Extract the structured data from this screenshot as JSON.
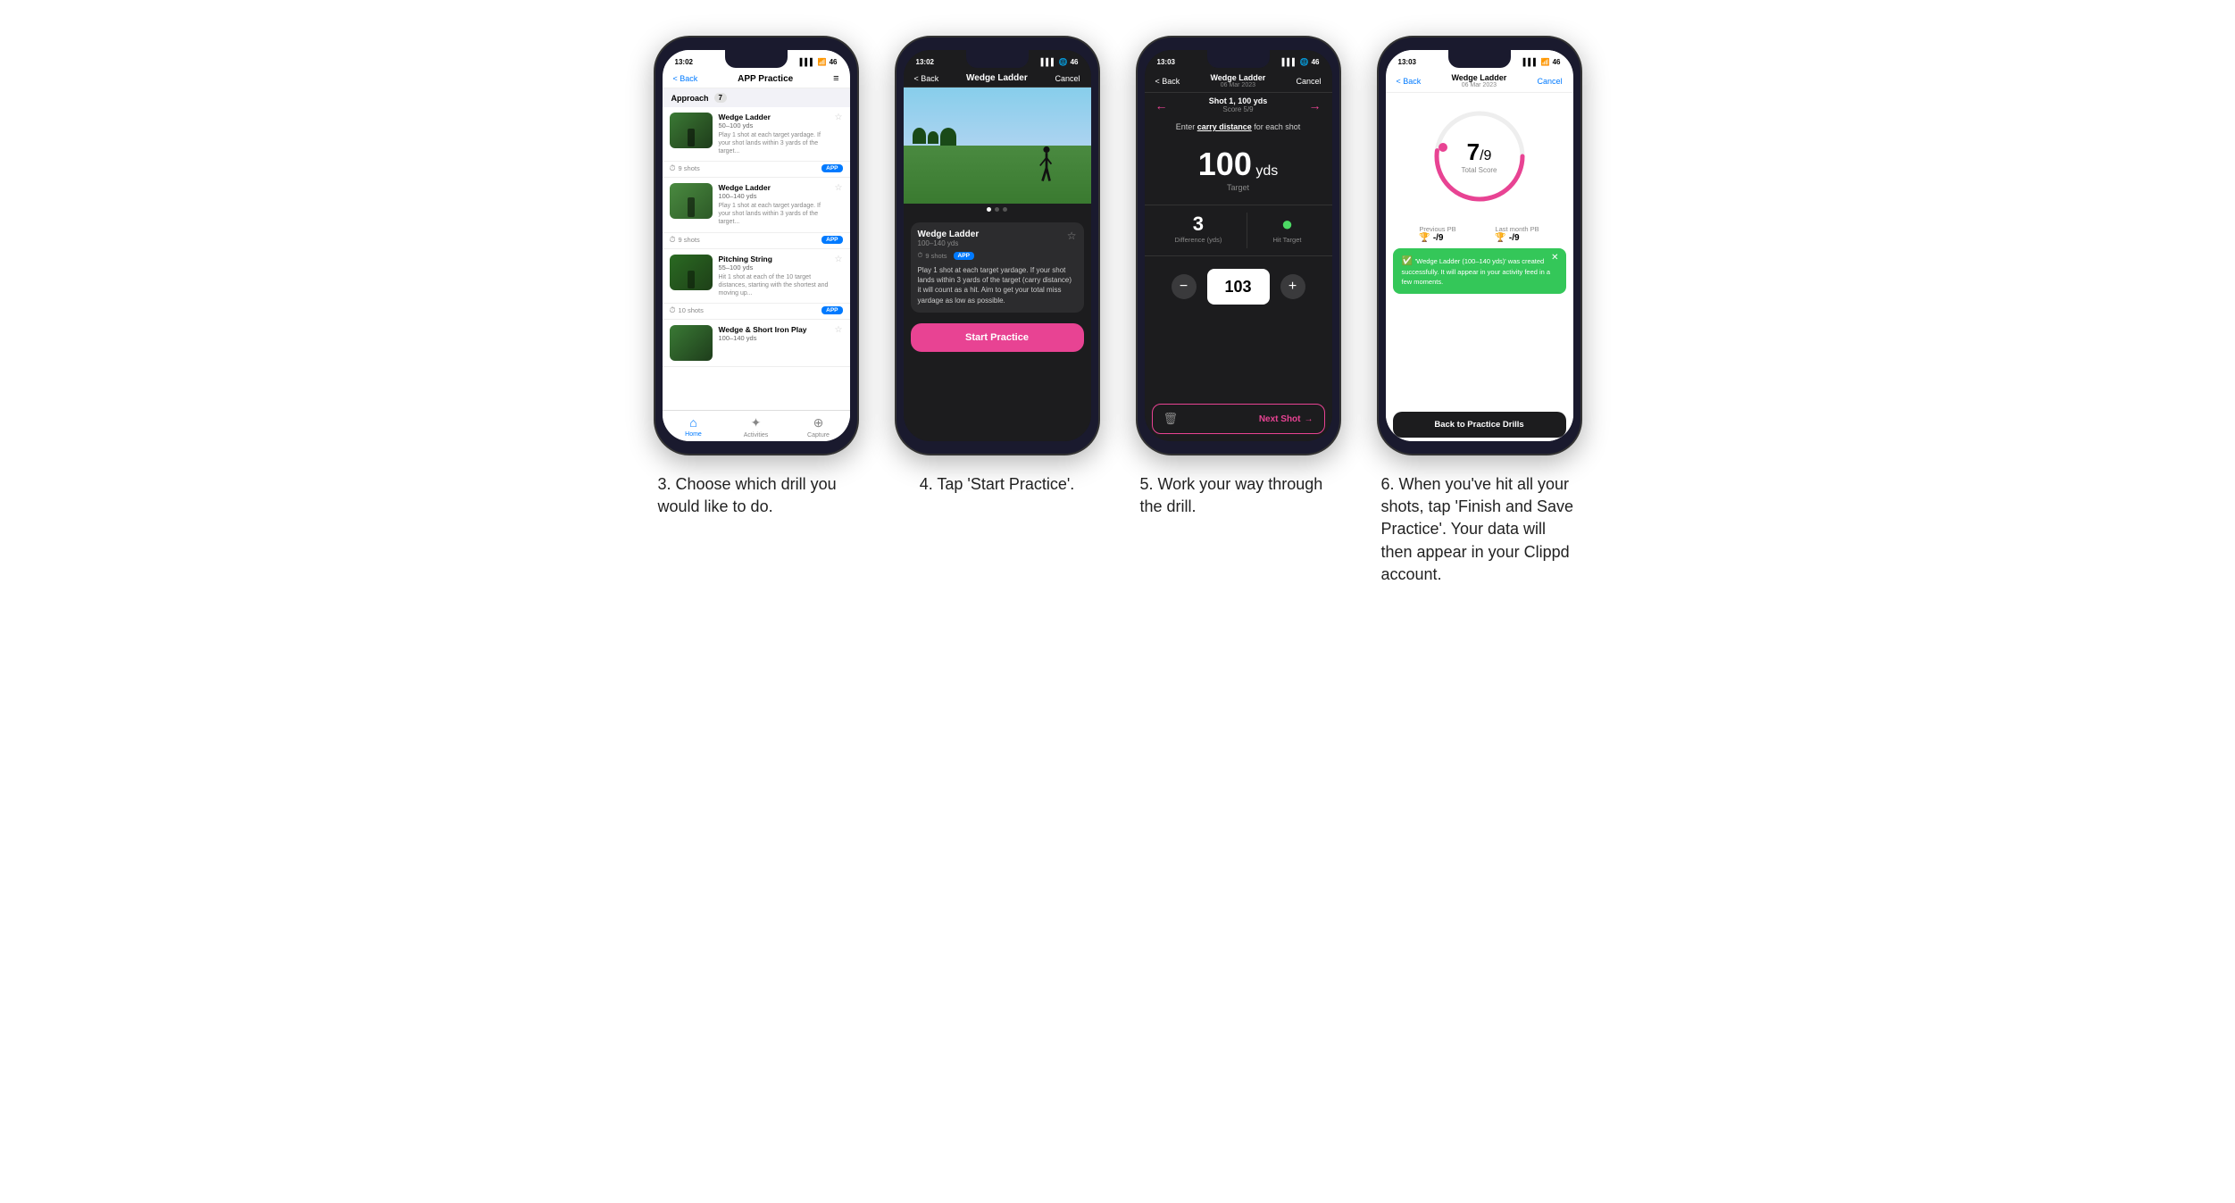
{
  "phones": [
    {
      "id": "phone3",
      "status_time": "13:02",
      "nav": {
        "back": "< Back",
        "title": "APP Practice",
        "icon": "≡"
      },
      "section": "Approach",
      "section_count": "7",
      "drills": [
        {
          "name": "Wedge Ladder",
          "range": "50–100 yds",
          "desc": "Play 1 shot at each target yardage. If your shot lands within 3 yards of the target...",
          "shots": "9 shots",
          "badge": "APP"
        },
        {
          "name": "Wedge Ladder",
          "range": "100–140 yds",
          "desc": "Play 1 shot at each target yardage. If your shot lands within 3 yards of the target...",
          "shots": "9 shots",
          "badge": "APP"
        },
        {
          "name": "Pitching String",
          "range": "55–100 yds",
          "desc": "Hit 1 shot at each of the 10 target distances, starting with the shortest and moving up...",
          "shots": "10 shots",
          "badge": "APP"
        },
        {
          "name": "Wedge & Short Iron Play",
          "range": "100–140 yds",
          "desc": "",
          "shots": "",
          "badge": ""
        }
      ],
      "tabs": [
        "Home",
        "Activities",
        "Capture"
      ]
    },
    {
      "id": "phone4",
      "status_time": "13:02",
      "nav": {
        "back": "< Back",
        "title": "Wedge Ladder",
        "cancel": "Cancel"
      },
      "drill_name": "Wedge Ladder",
      "drill_range": "100–140 yds",
      "shots": "9 shots",
      "badge": "APP",
      "description": "Play 1 shot at each target yardage. If your shot lands within 3 yards of the target (carry distance) it will count as a hit. Aim to get your total miss yardage as low as possible.",
      "start_btn": "Start Practice"
    },
    {
      "id": "phone5",
      "status_time": "13:03",
      "nav": {
        "back": "< Back",
        "title_line1": "Wedge Ladder",
        "title_line2": "06 Mar 2023",
        "cancel": "Cancel"
      },
      "shot_label": "Shot 1, 100 yds",
      "score_label": "Score 5/9",
      "carry_instruction": "Enter carry distance for each shot",
      "target_yds": "100",
      "target_unit": "yds",
      "target_label": "Target",
      "difference": "3",
      "difference_label": "Difference (yds)",
      "hit_target_label": "Hit Target",
      "input_value": "103",
      "next_shot": "Next Shot"
    },
    {
      "id": "phone6",
      "status_time": "13:03",
      "nav": {
        "back": "< Back",
        "title_line1": "Wedge Ladder",
        "title_line2": "06 Mar 2023",
        "cancel": "Cancel"
      },
      "score_num": "7",
      "score_denom": "/9",
      "score_total_label": "Total Score",
      "previous_pb_label": "Previous PB",
      "previous_pb_val": "-/9",
      "last_month_pb_label": "Last month PB",
      "last_month_pb_val": "-/9",
      "toast_msg": "'Wedge Ladder (100–140 yds)' was created successfully. It will appear in your activity feed in a few moments.",
      "back_btn": "Back to Practice Drills"
    }
  ],
  "captions": [
    "3. Choose which drill you would like to do.",
    "4. Tap 'Start Practice'.",
    "5. Work your way through the drill.",
    "6. When you've hit all your shots, tap 'Finish and Save Practice'. Your data will then appear in your Clippd account."
  ]
}
